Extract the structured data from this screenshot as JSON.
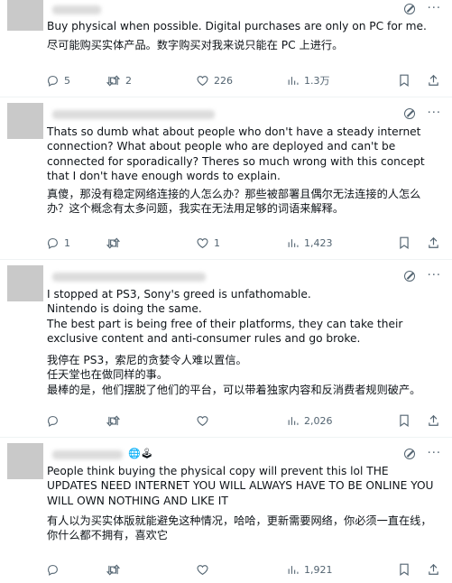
{
  "posts": [
    {
      "badges": "",
      "text_en": "Buy physical when possible. Digital purchases are only on PC for me.",
      "text_zh": "尽可能购买实体产品。数字购买对我来说只能在 PC 上进行。",
      "replies": "5",
      "retweets": "2",
      "likes": "226",
      "views": "1.3万"
    },
    {
      "badges": "",
      "text_en": "Thats so dumb what about people who don't have a steady internet connection? What about people who are deployed and can't be connected for sporadically? Theres so much wrong with this concept that I don't have enough words to explain.",
      "text_zh": "真傻，那没有稳定网络连接的人怎么办？那些被部署且偶尔无法连接的人怎么办？这个概念有太多问题，我实在无法用足够的词语来解释。",
      "replies": "1",
      "retweets": "",
      "likes": "1",
      "views": "1,423"
    },
    {
      "badges": "",
      "text_en": "I stopped at PS3, Sony's greed is  unfathomable.\nNintendo is doing the same.\nThe best part is being free of their platforms, they can take their exclusive content and anti-consumer rules and go broke.",
      "text_zh": "我停在 PS3，索尼的贪婪令人难以置信。\n任天堂也在做同样的事。\n最棒的是，他们摆脱了他们的平台，可以带着独家内容和反消费者规则破产。",
      "replies": "",
      "retweets": "",
      "likes": "",
      "views": "2,026"
    },
    {
      "badges": "🌐🕹",
      "text_en": "People think buying the physical copy will prevent this lol THE UPDATES NEED INTERNET YOU WILL ALWAYS HAVE TO BE ONLINE YOU WILL OWN NOTHING AND LIKE IT",
      "text_zh": "有人以为买实体版就能避免这种情况，哈哈，更新需要网络，你必须一直在线，你什么都不拥有，喜欢它",
      "replies": "",
      "retweets": "",
      "likes": "",
      "views": "1,921"
    }
  ],
  "icons": {
    "header": [
      "grok-icon",
      "more-icon"
    ],
    "actions": [
      "reply-icon",
      "retweet-icon",
      "like-icon",
      "views-icon",
      "bookmark-icon",
      "share-icon"
    ]
  },
  "colors": {
    "text": "#0f1419",
    "muted": "#536471",
    "divider": "#eff3f4",
    "avatar": "#c9c9c9"
  }
}
